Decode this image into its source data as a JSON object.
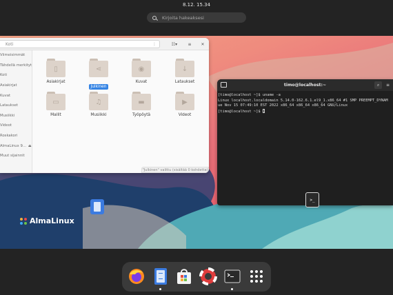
{
  "topbar": {
    "clock": "8.12.  15.34"
  },
  "search": {
    "placeholder": "Kirjoita hakeaksesi"
  },
  "brand": {
    "name": "AlmaLinux"
  },
  "files": {
    "path_text": "Koti",
    "sidebar": [
      "Viimeisimmät",
      "Tähdellä merkityt",
      "Koti",
      "Asiakirjat",
      "Kuvat",
      "Lataukset",
      "Musiikki",
      "Videot",
      "Roskakori",
      "AlmaLinux 9...",
      "Muut sijainnit"
    ],
    "folders": [
      {
        "name": "Asiakirjat",
        "icon": "document-icon"
      },
      {
        "name": "Julkinen",
        "icon": "share-icon",
        "selected": true
      },
      {
        "name": "Kuvat",
        "icon": "camera-icon"
      },
      {
        "name": "Lataukset",
        "icon": "download-icon"
      },
      {
        "name": "Mallit",
        "icon": "template-icon"
      },
      {
        "name": "Musiikki",
        "icon": "music-icon"
      },
      {
        "name": "Työpöytä",
        "icon": "desktop-icon"
      },
      {
        "name": "Videot",
        "icon": "video-icon"
      }
    ],
    "status": "\"Julkinen\" valittu (sisältää 0 kohdetta)"
  },
  "terminal": {
    "title": "timo@localhost:~",
    "lines": [
      "[timo@localhost ~]$ uname -a",
      "Linux localhost.localdomain 5.14.0-162.6.1.el9_1.x86_64 #1 SMP PREEMPT_DYNAM",
      "ue Nov 15 07:49:10 EST 2022 x86_64 x86_64 x86_64 GNU/Linux",
      "[timo@localhost ~]$ "
    ]
  },
  "dock": {
    "apps": [
      {
        "name": "Firefox",
        "icon": "firefox-icon",
        "running": false
      },
      {
        "name": "Tiedostot",
        "icon": "files-icon",
        "running": true
      },
      {
        "name": "Ohjelmistot",
        "icon": "software-icon",
        "running": false
      },
      {
        "name": "Ohje",
        "icon": "help-icon",
        "running": false
      },
      {
        "name": "Pääte",
        "icon": "terminal-icon",
        "running": true
      },
      {
        "name": "Sovellukset",
        "icon": "app-grid-icon",
        "running": false
      }
    ]
  },
  "colors": {
    "accent": "#3584e4",
    "wallpaper_top": "#f2a285",
    "wallpaper_mid": "#e6626e",
    "wave_teal": "#5fb5b9",
    "wave_navy": "#1f3f6b"
  }
}
